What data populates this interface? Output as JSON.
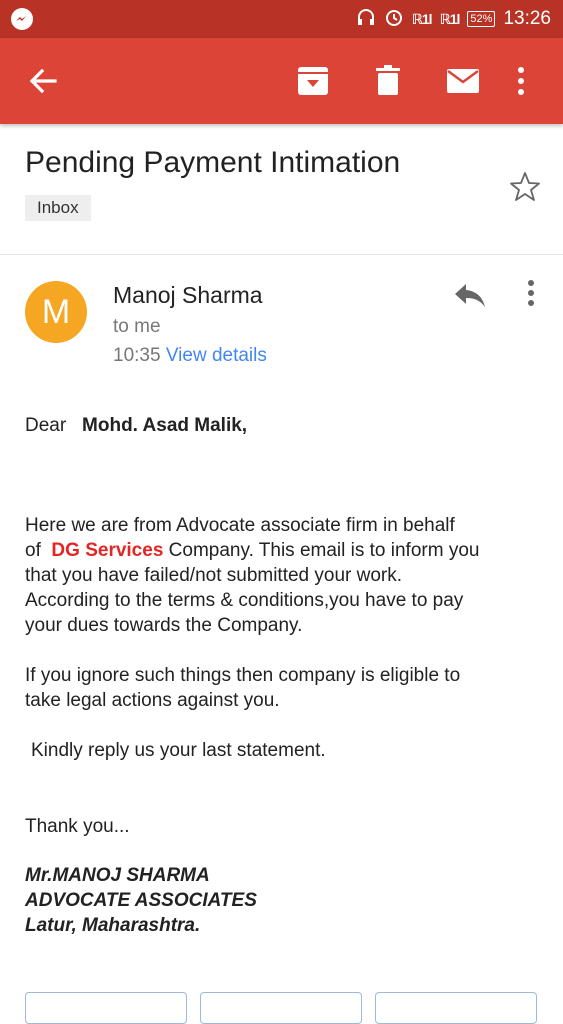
{
  "status_bar": {
    "signal_1": "ℝ1l",
    "signal_2": "ℝ1l",
    "battery": "52%",
    "time": "13:26"
  },
  "toolbar": {
    "icons": [
      "back-arrow-icon",
      "archive-icon",
      "delete-icon",
      "mark-unread-icon",
      "more-vert-icon"
    ]
  },
  "email": {
    "subject": "Pending Payment Intimation",
    "label": "Inbox",
    "sender": {
      "initial": "M",
      "name": "Manoj Sharma",
      "to": "to me",
      "time": "10:35",
      "details_link": "View details",
      "avatar_color": "#f5a623"
    },
    "body": {
      "salutation": "Dear",
      "recipient": "Mohd. Asad Malik,",
      "p1_line1": "Here we are from Advocate associate firm in behalf",
      "p1_line2_pre": "of",
      "p1_company": "DG Services",
      "p1_line2_post": "Company. This email is to inform you",
      "p1_line3": "that you have failed/not submitted your work.",
      "p1_line4": "According to the terms & conditions,you have to pay",
      "p1_line5": "your dues towards the Company.",
      "p2_line1": "If you ignore such things then company is eligible to",
      "p2_line2": "take legal actions against you.",
      "p3": "Kindly reply us your last statement.",
      "closing": "Thank you...",
      "sig_line1": "Mr.MANOJ SHARMA",
      "sig_line2": "ADVOCATE ASSOCIATES",
      "sig_line3": "Latur, Maharashtra."
    }
  },
  "colors": {
    "status_bar": "#b83326",
    "app_bar": "#db4437",
    "link": "#4285f4",
    "highlight": "#e52525"
  }
}
